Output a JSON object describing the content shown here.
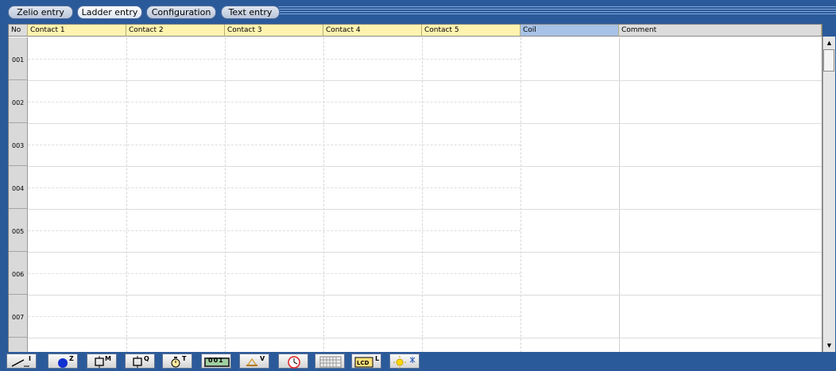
{
  "tabs": [
    {
      "label": "Zelio entry"
    },
    {
      "label": "Ladder entry"
    },
    {
      "label": "Configuration"
    },
    {
      "label": "Text entry"
    }
  ],
  "grid": {
    "columns": [
      "No",
      "Contact 1",
      "Contact 2",
      "Contact 3",
      "Contact 4",
      "Contact 5",
      "Coil",
      "Comment"
    ],
    "rows": [
      "001",
      "002",
      "003",
      "004",
      "005",
      "006",
      "007"
    ]
  },
  "toolbar": {
    "tools": [
      {
        "icon": "contact-input-icon",
        "letter": "I"
      },
      {
        "icon": "zx-key-icon",
        "letter": "Z"
      },
      {
        "icon": "auxiliary-relay-icon",
        "letter": "M"
      },
      {
        "icon": "output-relay-icon",
        "letter": "Q"
      },
      {
        "icon": "timer-icon",
        "letter": "T"
      },
      {
        "icon": "counter-icon",
        "letter": "001"
      },
      {
        "icon": "analog-comparator-icon",
        "letter": "V"
      },
      {
        "icon": "clock-icon",
        "letter": ""
      },
      {
        "icon": "keypad-icon",
        "letter": ""
      },
      {
        "icon": "lcd-text-icon",
        "letter": "L"
      },
      {
        "icon": "summer-winter-icon",
        "letter": ""
      }
    ]
  }
}
